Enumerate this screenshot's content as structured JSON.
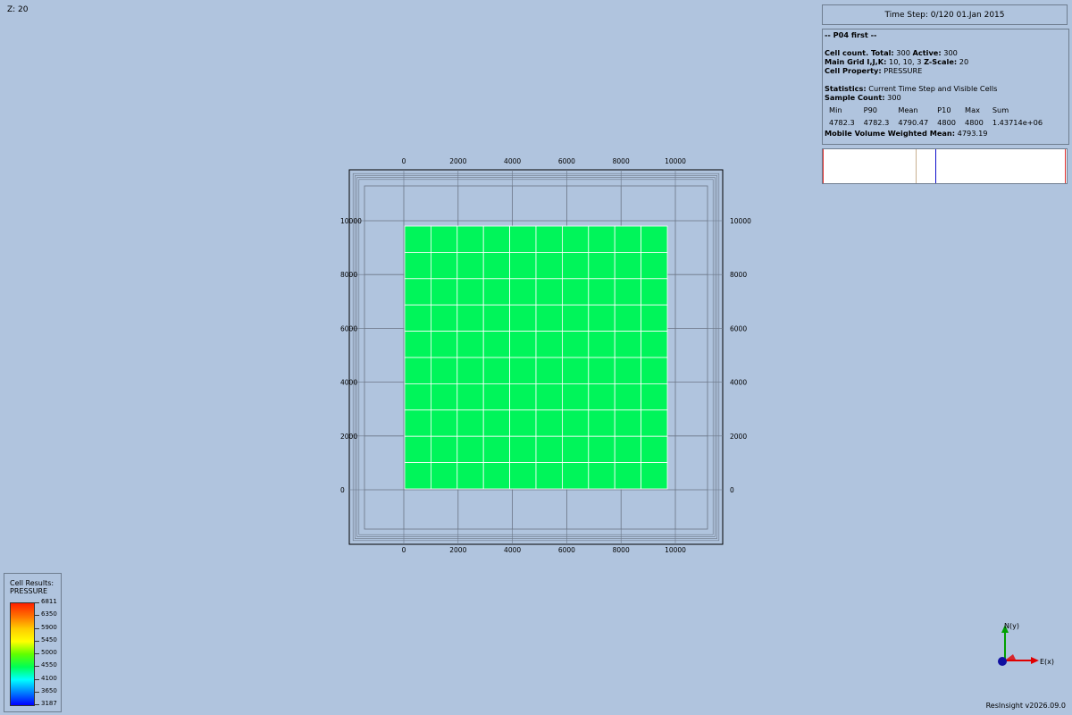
{
  "view": {
    "z_label": "Z: 20"
  },
  "timestep": {
    "text": "Time Step: 0/120 01.Jan 2015"
  },
  "info": {
    "case_title": "-- P04 first --",
    "cell_count_label": "Cell count. Total:",
    "cell_count_total": "300",
    "active_label": "Active:",
    "active_value": "300",
    "main_grid_label": "Main Grid I,J,K:",
    "main_grid_value": "10, 10, 3",
    "zscale_label": "Z-Scale:",
    "zscale_value": "20",
    "cell_property_label": "Cell Property:",
    "cell_property_value": "PRESSURE",
    "statistics_label": "Statistics:",
    "statistics_value": "Current Time Step and Visible Cells",
    "sample_count_label": "Sample Count:",
    "sample_count_value": "300",
    "stats_headers": [
      "Min",
      "P90",
      "Mean",
      "P10",
      "Max",
      "Sum"
    ],
    "stats_values": [
      "4782.3",
      "4782.3",
      "4790.47",
      "4800",
      "4800",
      "1.43714e+06"
    ],
    "mobile_label": "Mobile Volume Weighted Mean:",
    "mobile_value": "4793.19"
  },
  "histogram": {
    "markers": [
      {
        "pos": 0.0,
        "color": "#e03030"
      },
      {
        "pos": 0.38,
        "color": "#c8b090"
      },
      {
        "pos": 0.46,
        "color": "#1010cc"
      },
      {
        "pos": 1.0,
        "color": "#e03030"
      }
    ]
  },
  "grid": {
    "x_ticks": [
      "0",
      "2000",
      "4000",
      "6000",
      "8000",
      "10000"
    ],
    "y_ticks": [
      "10000",
      "8000",
      "6000",
      "4000",
      "2000",
      "0"
    ],
    "cell_color": "#00f55a",
    "cells_i": 10,
    "cells_j": 10
  },
  "legend": {
    "title_line1": "Cell Results:",
    "title_line2": "PRESSURE",
    "levels": [
      "6811",
      "6350",
      "5900",
      "5450",
      "5000",
      "4550",
      "4100",
      "3650",
      "3187"
    ]
  },
  "axes": {
    "north_label": "N(y)",
    "east_label": "E(x)"
  },
  "footer": {
    "version": "ResInsight v2026.09.0"
  }
}
